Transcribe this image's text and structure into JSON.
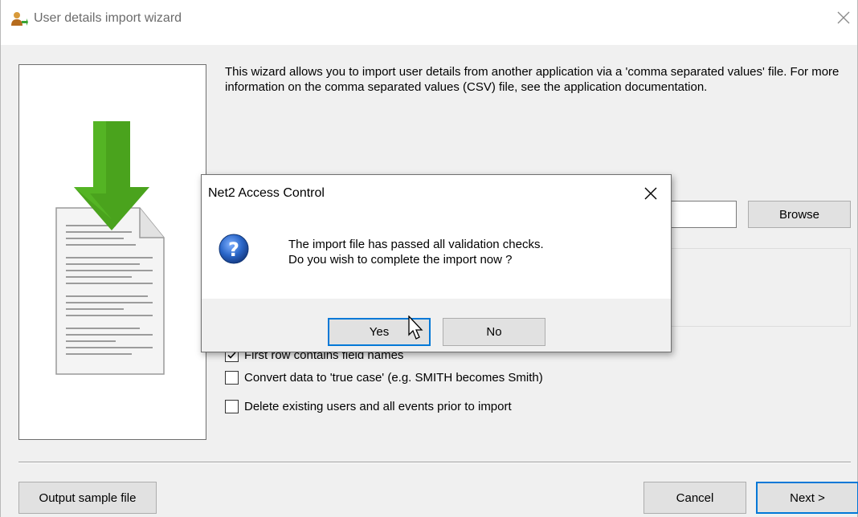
{
  "window": {
    "title": "User details import wizard",
    "icon": "user-import-icon",
    "close_icon": "close-icon"
  },
  "intro": {
    "text": "This wizard allows you to import user details from another application via a 'comma separated values' file. For more information on the comma separated values (CSV) file, see the application documentation."
  },
  "file": {
    "value": "",
    "browse_label": "Browse"
  },
  "options": [
    {
      "label": "First row contains field names",
      "checked": true
    },
    {
      "label": "Convert data to 'true case' (e.g. SMITH becomes Smith)",
      "checked": false
    },
    {
      "label": "Delete existing users and all events prior to import",
      "checked": false
    }
  ],
  "footer": {
    "output_sample_label": "Output sample file",
    "cancel_label": "Cancel",
    "next_label": "Next >"
  },
  "dialog": {
    "title": "Net2 Access Control",
    "line1": "The import file has passed all validation checks.",
    "line2": "Do you wish to complete the import now ?",
    "yes_label": "Yes",
    "no_label": "No",
    "icon": "question-icon"
  },
  "colors": {
    "accent": "#0078d7",
    "arrow_green": "#4aa31d",
    "question_blue": "#1f5fbf"
  }
}
